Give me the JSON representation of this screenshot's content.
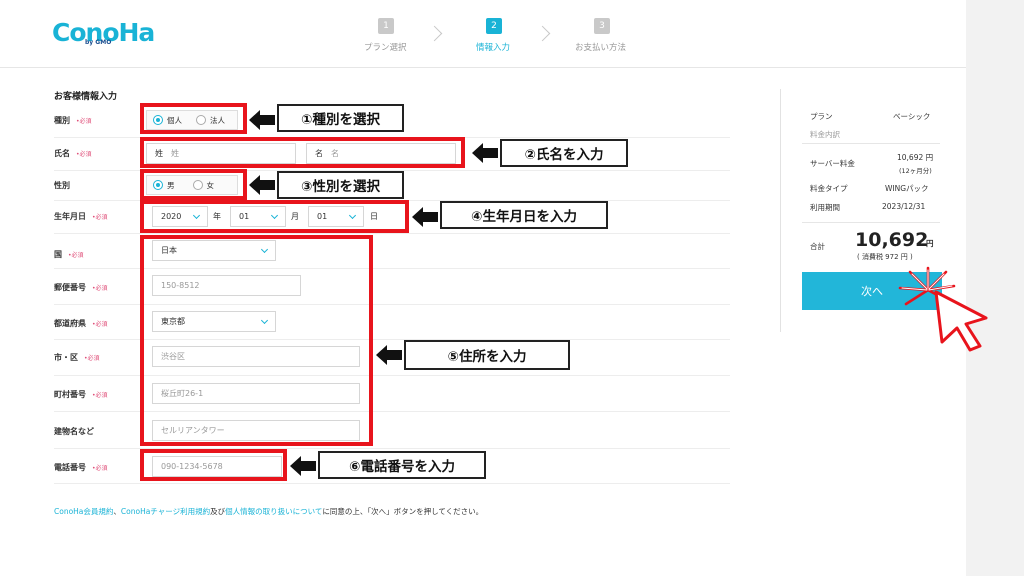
{
  "header": {
    "logo": "ConoHa",
    "logo_sub": "by GMO",
    "steps": [
      {
        "num": "1",
        "label": "プラン選択",
        "active": false
      },
      {
        "num": "2",
        "label": "情報入力",
        "active": true
      },
      {
        "num": "3",
        "label": "お支払い方法",
        "active": false
      }
    ]
  },
  "form": {
    "section_title": "お客様情報入力",
    "required_mark": "•必須",
    "type": {
      "label": "種別",
      "options": [
        "個人",
        "法人"
      ],
      "selected": "個人"
    },
    "name": {
      "label": "氏名",
      "last_prefix": "姓",
      "last_placeholder": "姓",
      "first_prefix": "名",
      "first_placeholder": "名"
    },
    "gender": {
      "label": "性別",
      "options": [
        "男",
        "女"
      ],
      "selected": "男"
    },
    "birthday": {
      "label": "生年月日",
      "year": "2020",
      "year_unit": "年",
      "month": "01",
      "month_unit": "月",
      "day": "01",
      "day_unit": "日"
    },
    "country": {
      "label": "国",
      "value": "日本"
    },
    "postal": {
      "label": "郵便番号",
      "placeholder": "150-8512"
    },
    "prefecture": {
      "label": "都道府県",
      "value": "東京都"
    },
    "city": {
      "label": "市・区",
      "placeholder": "渋谷区"
    },
    "street": {
      "label": "町村番号",
      "placeholder": "桜丘町26-1"
    },
    "building": {
      "label": "建物名など",
      "placeholder": "セルリアンタワー"
    },
    "phone": {
      "label": "電話番号",
      "placeholder": "090-1234-5678"
    }
  },
  "annotations": {
    "type": "①種別を選択",
    "name": "②氏名を入力",
    "gender": "③性別を選択",
    "birthday": "④生年月日を入力",
    "address": "⑤住所を入力",
    "phone": "⑥電話番号を入力"
  },
  "summary": {
    "plan_label": "プラン",
    "plan_value": "ベーシック",
    "details_label": "料金内訳",
    "server_fee_label": "サーバー料金",
    "server_fee_value": "10,692 円",
    "server_fee_sub": "(12ヶ月分)",
    "fee_type_label": "料金タイプ",
    "fee_type_value": "WINGパック",
    "period_label": "利用期間",
    "period_value": "2023/12/31",
    "total_label": "合計",
    "total_value": "10,692",
    "total_unit": "円",
    "tax_note": "( 消費税 972 円 )",
    "next_button": "次へ"
  },
  "footer": {
    "link1": "ConoHa会員規約",
    "sep1": "、",
    "link2": "ConoHaチャージ利用規約",
    "sep2": "及び",
    "link3": "個人情報の取り扱いについて",
    "rest": "に同意の上、「次へ」ボタンを押してください。"
  },
  "colors": {
    "accent": "#19b3d6",
    "annotation_red": "#e8141c",
    "required": "#e0507a"
  }
}
